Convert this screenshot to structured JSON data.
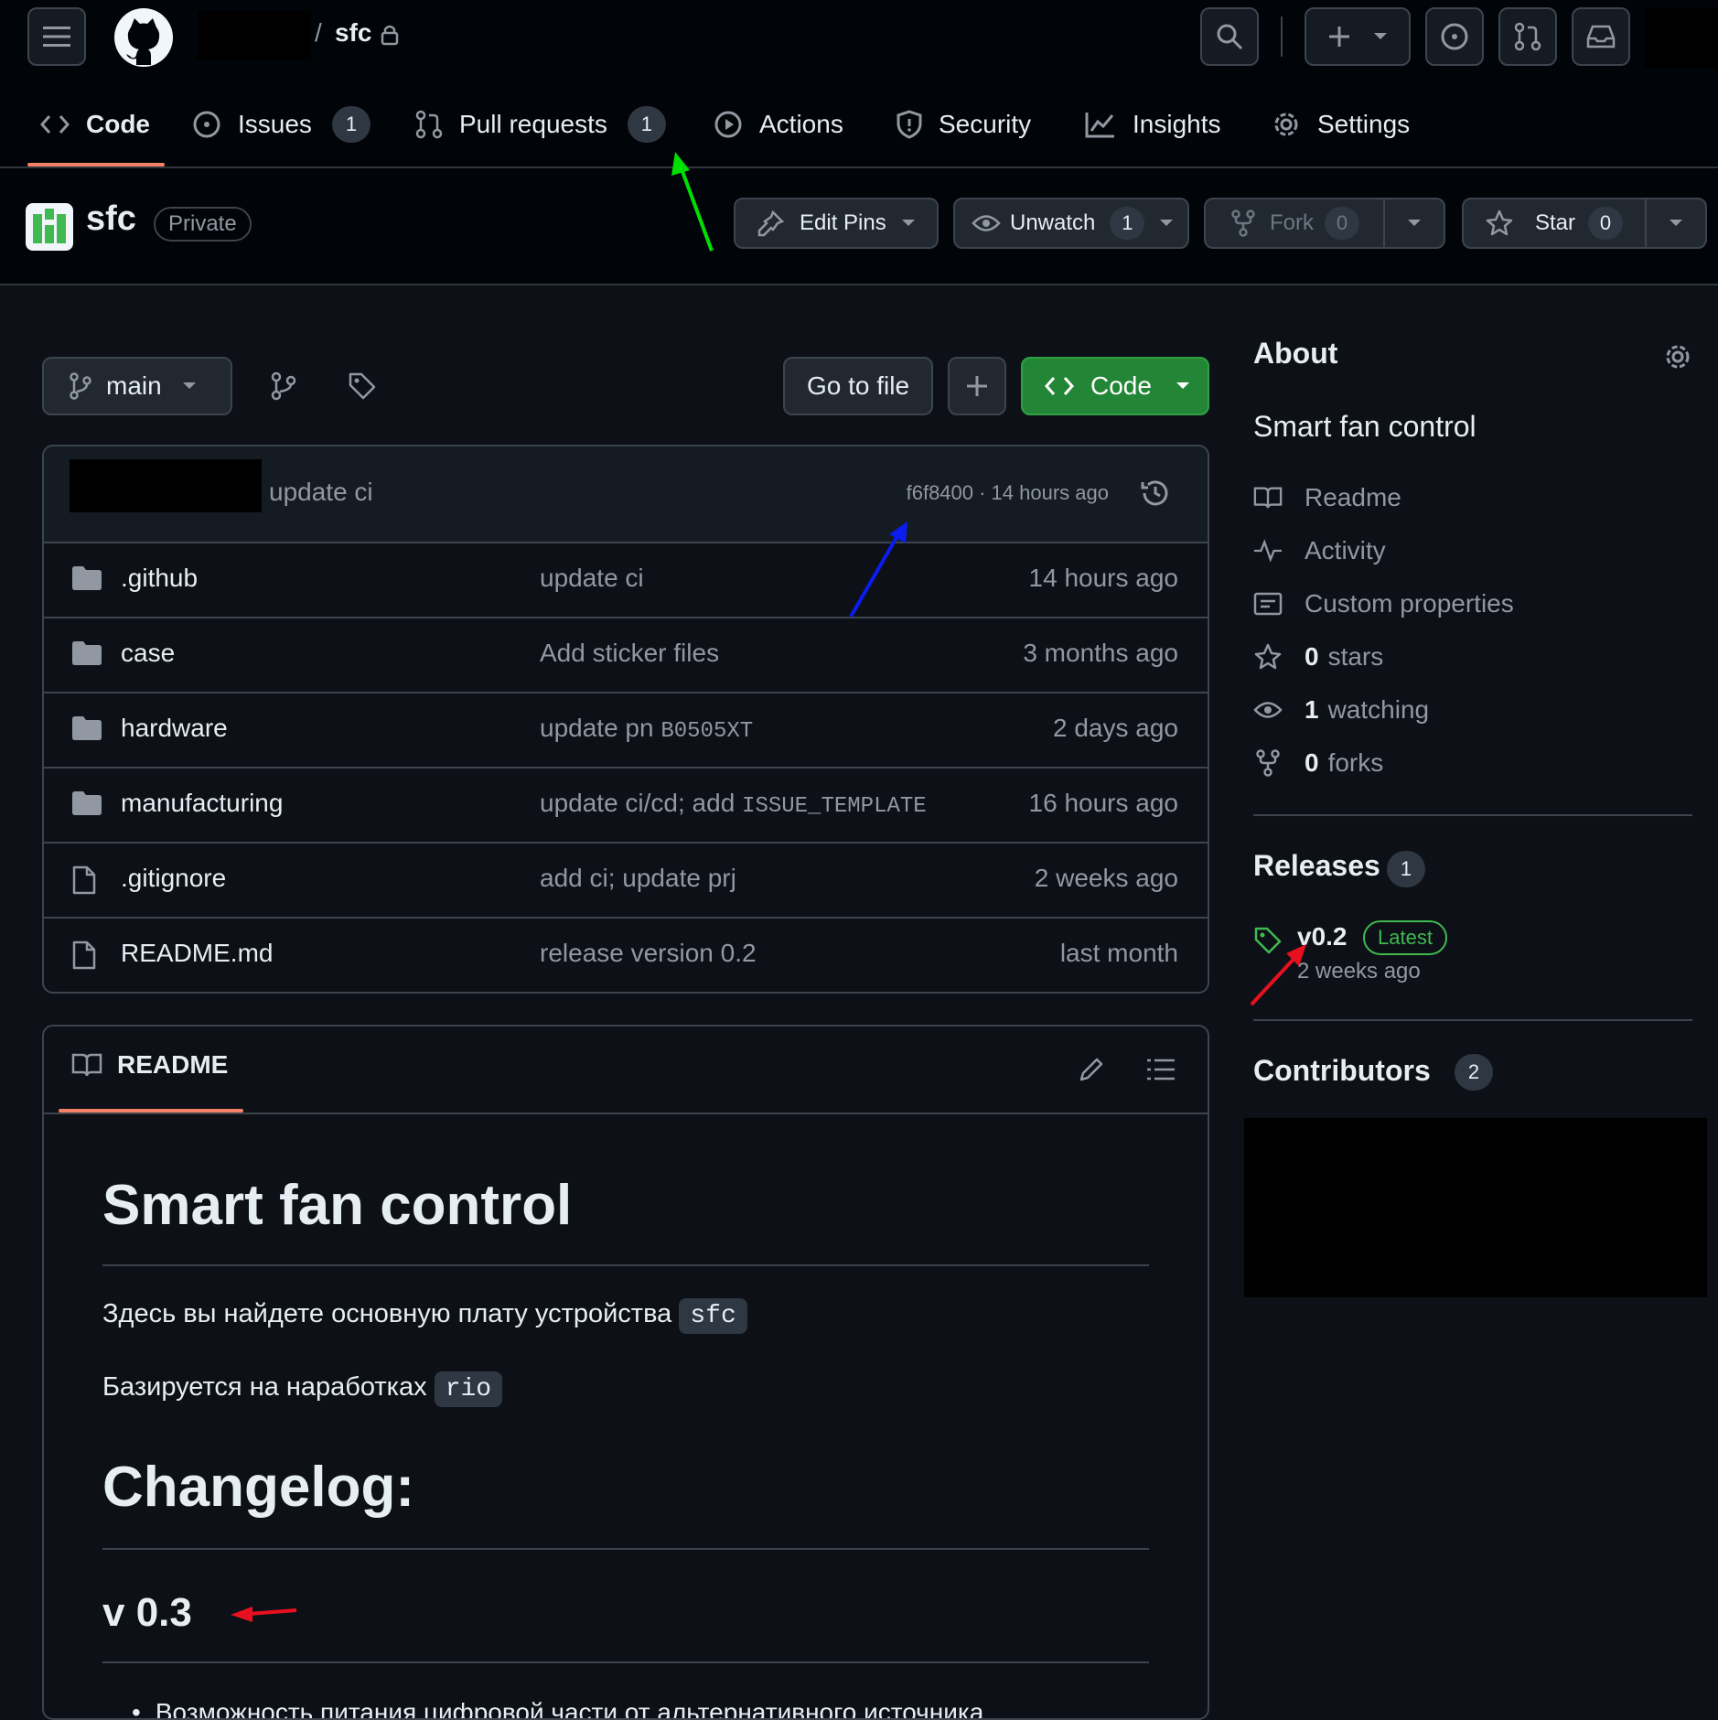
{
  "topbar": {
    "repo_name": "sfc",
    "separator": "/",
    "icons": [
      "menu-icon",
      "github-logo",
      "lock-icon",
      "search-icon",
      "plus-icon",
      "issue-icon",
      "pull-request-icon",
      "inbox-icon"
    ]
  },
  "tabs": [
    {
      "label": "Code",
      "icon": "code-icon"
    },
    {
      "label": "Issues",
      "icon": "issue-icon",
      "count": "1"
    },
    {
      "label": "Pull requests",
      "icon": "pull-request-icon",
      "count": "1"
    },
    {
      "label": "Actions",
      "icon": "play-icon"
    },
    {
      "label": "Security",
      "icon": "shield-icon"
    },
    {
      "label": "Insights",
      "icon": "graph-icon"
    },
    {
      "label": "Settings",
      "icon": "gear-icon"
    }
  ],
  "repo_header": {
    "title": "sfc",
    "visibility": "Private",
    "edit_pins": "Edit Pins",
    "unwatch": "Unwatch",
    "unwatch_count": "1",
    "fork": "Fork",
    "fork_count": "0",
    "star": "Star",
    "star_count": "0"
  },
  "toolbar": {
    "branch": "main",
    "go_to_file": "Go to file",
    "add_label": "+",
    "code_button": "Code"
  },
  "latest_commit": {
    "message": "update ci",
    "hash_time": "f6f8400 · 14 hours ago"
  },
  "files": [
    {
      "name": ".github",
      "type": "folder",
      "message": "update ci",
      "code": "",
      "age": "14 hours ago"
    },
    {
      "name": "case",
      "type": "folder",
      "message": "Add sticker files",
      "code": "",
      "age": "3 months ago"
    },
    {
      "name": "hardware",
      "type": "folder",
      "message": "update pn ",
      "code": "B0505XT",
      "age": "2 days ago"
    },
    {
      "name": "manufacturing",
      "type": "folder",
      "message": "update ci/cd; add ",
      "code": "ISSUE_TEMPLATE",
      "age": "16 hours ago"
    },
    {
      "name": ".gitignore",
      "type": "file",
      "message": "add ci; update prj",
      "code": "",
      "age": "2 weeks ago"
    },
    {
      "name": "README.md",
      "type": "file",
      "message": "release version 0.2",
      "code": "",
      "age": "last month"
    }
  ],
  "readme": {
    "tab_label": "README",
    "h1": "Smart fan control",
    "p1": "Здесь вы найдете основную плату устройства ",
    "p1_code": "sfc",
    "p2": "Базируется на наработках ",
    "p2_code": "rio",
    "h1_changelog": "Changelog:",
    "h2_version": "v 0.3",
    "bullet_partial": "Возможность питания цифровой части от альтернативного источника"
  },
  "about": {
    "title": "About",
    "description": "Smart fan control",
    "readme": "Readme",
    "activity": "Activity",
    "custom_properties": "Custom properties",
    "stars_count": "0",
    "stars_label": "stars",
    "watching_count": "1",
    "watching_label": "watching",
    "forks_count": "0",
    "forks_label": "forks"
  },
  "releases": {
    "title": "Releases",
    "count": "1",
    "tag": "v0.2",
    "latest_badge": "Latest",
    "time": "2 weeks ago"
  },
  "contributors": {
    "title": "Contributors",
    "count": "2"
  },
  "colors": {
    "annotation_green": "#00e000",
    "annotation_blue": "#0a1cf0",
    "annotation_red": "#e8101e",
    "code_button_green": "#238636",
    "active_tab_underline": "#f78166",
    "latest_badge": "#3fb950"
  }
}
